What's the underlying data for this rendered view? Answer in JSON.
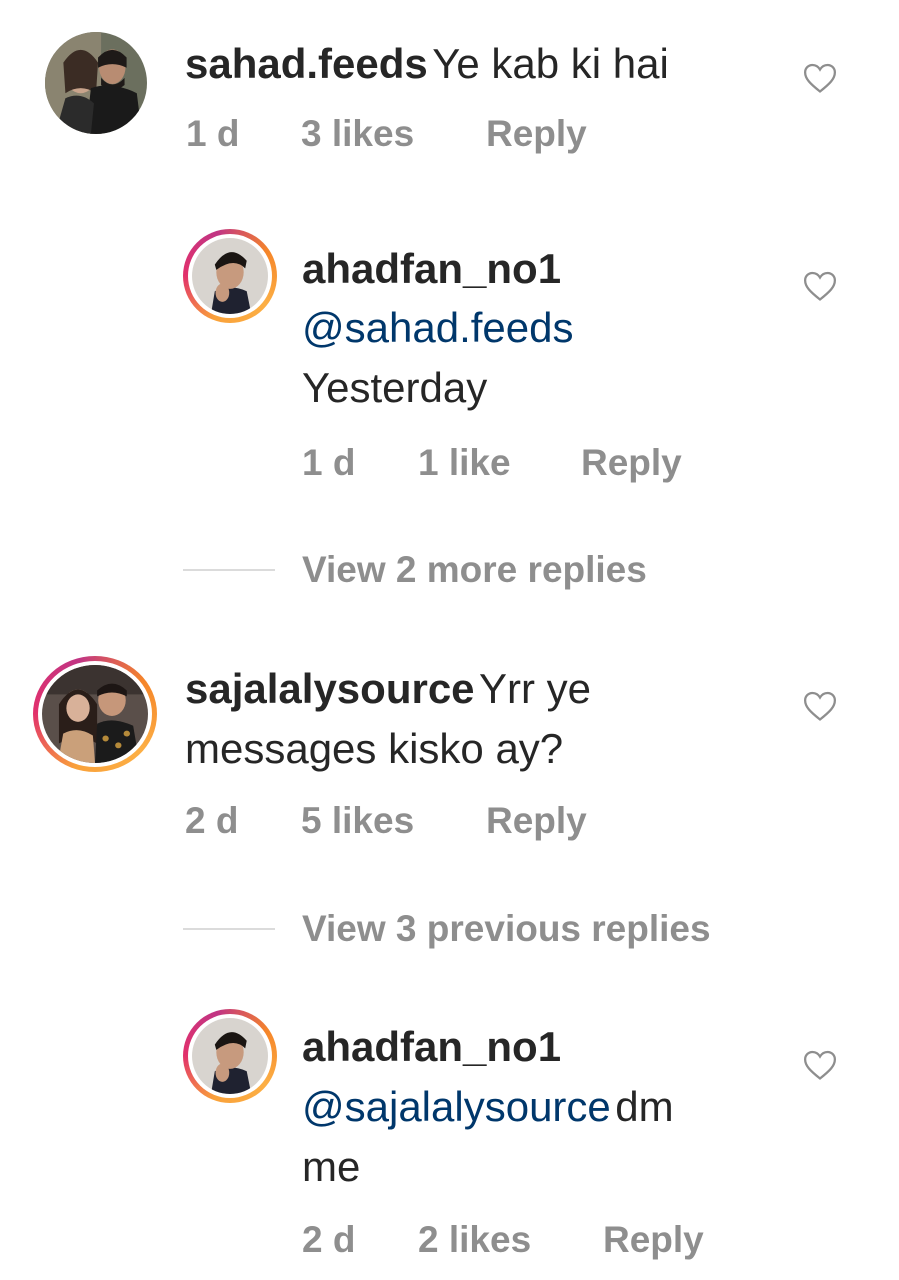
{
  "comments": [
    {
      "username": "sahad.feeds",
      "text": "Ye kab ki hai",
      "time": "1 d",
      "likes": "3 likes",
      "reply": "Reply"
    },
    {
      "username": "ahadfan_no1",
      "mention": "@sahad.feeds",
      "text": "Yesterday",
      "time": "1 d",
      "likes": "1 like",
      "reply": "Reply"
    },
    {
      "username": "sajalalysource",
      "text_line1": "Yrr ye",
      "text_line2": "messages kisko ay?",
      "time": "2 d",
      "likes": "5 likes",
      "reply": "Reply"
    },
    {
      "username": "ahadfan_no1",
      "mention": "@sajalalysource",
      "text_line1": "dm",
      "text_line2": "me",
      "time": "2 d",
      "likes": "2 likes",
      "reply": "Reply"
    }
  ],
  "view_more_1": "View 2 more replies",
  "view_more_2": "View 3 previous replies",
  "icons": {
    "like": "heart-outline-icon"
  },
  "colors": {
    "text": "#262626",
    "meta": "#8e8e8e",
    "mention": "#00376b",
    "divider": "#dbdbdb"
  }
}
